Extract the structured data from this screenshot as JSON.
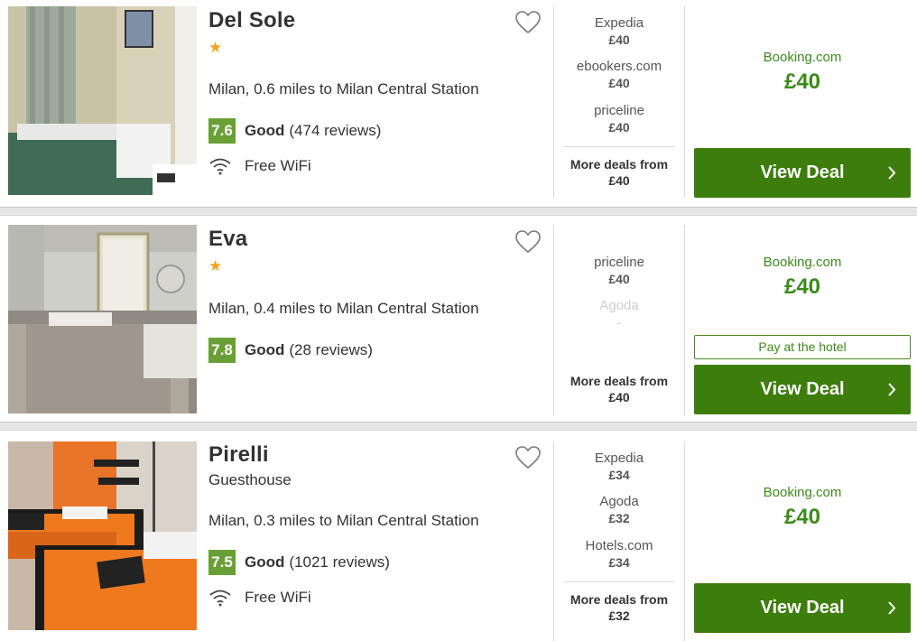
{
  "colors": {
    "score_bg": "#6a9f36",
    "deal_button": "#3d7d0c",
    "best_green": "#3b8a1a",
    "star": "#f4a223"
  },
  "icons": {
    "star": "★",
    "heart": "heart-icon",
    "wifi": "wifi-icon",
    "chevron": "chevron-right-icon"
  },
  "hotels": [
    {
      "name": "Del Sole",
      "location": "Milan, 0.6 miles to Milan Central Station",
      "score": "7.6",
      "rating_word": "Good",
      "reviews": "(474 reviews)",
      "amenity": "Free WiFi",
      "deals": [
        {
          "provider": "Expedia",
          "price": "£40"
        },
        {
          "provider": "ebookers.com",
          "price": "£40"
        },
        {
          "provider": "priceline",
          "price": "£40"
        }
      ],
      "more_label": "More deals from",
      "more_price": "£40",
      "best_provider": "Booking.com",
      "best_price": "£40",
      "view_deal": "View Deal"
    },
    {
      "name": "Eva",
      "location": "Milan, 0.4 miles to Milan Central Station",
      "score": "7.8",
      "rating_word": "Good",
      "reviews": "(28 reviews)",
      "deals": [
        {
          "provider": "priceline",
          "price": "£40"
        },
        {
          "provider": "Agoda",
          "price": "-"
        }
      ],
      "more_label": "More deals from",
      "more_price": "£40",
      "best_provider": "Booking.com",
      "best_price": "£40",
      "pay_label": "Pay at the hotel",
      "view_deal": "View Deal"
    },
    {
      "name": "Pirelli",
      "type": "Guesthouse",
      "location": "Milan, 0.3 miles to Milan Central Station",
      "score": "7.5",
      "rating_word": "Good",
      "reviews": "(1021 reviews)",
      "amenity": "Free WiFi",
      "deals": [
        {
          "provider": "Expedia",
          "price": "£34"
        },
        {
          "provider": "Agoda",
          "price": "£32"
        },
        {
          "provider": "Hotels.com",
          "price": "£34"
        }
      ],
      "more_label": "More deals from",
      "more_price": "£32",
      "best_provider": "Booking.com",
      "best_price": "£40",
      "view_deal": "View Deal"
    }
  ]
}
